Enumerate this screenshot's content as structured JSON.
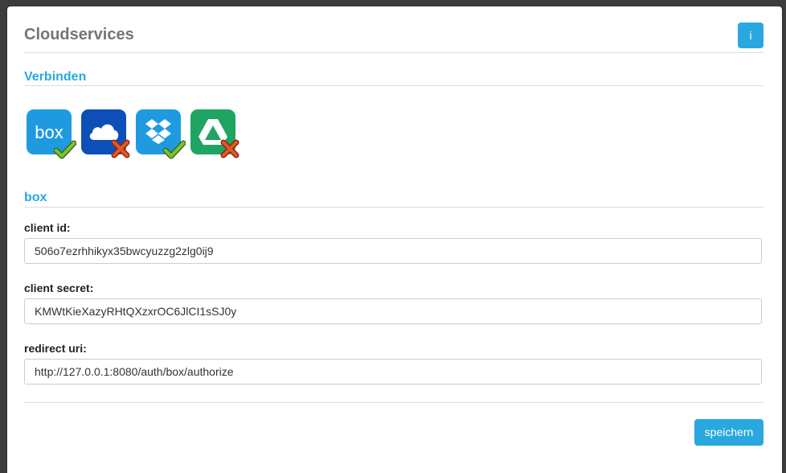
{
  "header": {
    "title": "Cloudservices",
    "info_label": "i"
  },
  "connect": {
    "title": "Verbinden",
    "services": [
      {
        "name": "box",
        "status": "connected",
        "brand_color": "#1f9ae0"
      },
      {
        "name": "onedrive",
        "status": "disconnected",
        "brand_color": "#0c4fb8"
      },
      {
        "name": "dropbox",
        "status": "connected",
        "brand_color": "#1f9ae0"
      },
      {
        "name": "google-drive",
        "status": "disconnected",
        "brand_color": "#1fa463"
      }
    ]
  },
  "settings": {
    "title": "box",
    "client_id_label": "client id:",
    "client_id_value": "506o7ezrhhikyx35bwcyuzzg2zlg0ij9",
    "client_secret_label": "client secret:",
    "client_secret_value": "KMWtKieXazyRHtQXzxrOC6JlCI1sSJ0y",
    "redirect_uri_label": "redirect uri:",
    "redirect_uri_value": "http://127.0.0.1:8080/auth/box/authorize"
  },
  "footer": {
    "save_label": "speichern"
  },
  "colors": {
    "accent": "#29a8e0",
    "check": "#6aa82c",
    "cross": "#e2582a"
  }
}
